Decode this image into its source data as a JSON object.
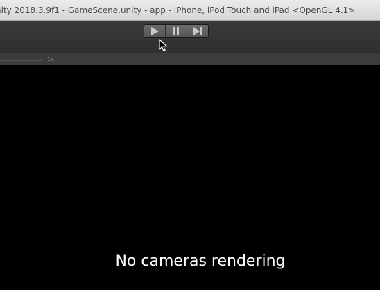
{
  "window": {
    "title": "nity 2018.3.9f1 - GameScene.unity - app - iPhone, iPod Touch and iPad <OpenGL 4.1>"
  },
  "toolbar": {
    "controls": [
      {
        "name": "play",
        "icon": "play-icon"
      },
      {
        "name": "pause",
        "icon": "pause-icon"
      },
      {
        "name": "step",
        "icon": "step-icon"
      }
    ]
  },
  "game_view": {
    "scale_label": "1x",
    "message": "No cameras rendering",
    "background": "#000000"
  },
  "colors": {
    "titlebar": "#e0e0e0",
    "toolbar": "#353535",
    "button": "#606060",
    "icon": "#c8c8c8"
  }
}
